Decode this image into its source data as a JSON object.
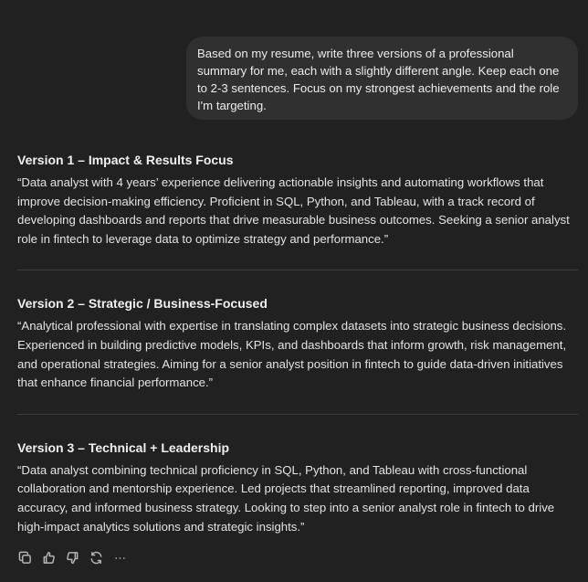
{
  "user_message": {
    "text": "Based on my resume, write three versions of a professional summary for me, each with a slightly different angle. Keep each one to 2-3 sentences. Focus on my strongest achievements and the role I'm targeting."
  },
  "assistant_response": {
    "versions": [
      {
        "title": "Version 1 – Impact & Results Focus",
        "body": "“Data analyst with 4 years’ experience delivering actionable insights and automating workflows that improve decision-making efficiency. Proficient in SQL, Python, and Tableau, with a track record of developing dashboards and reports that drive measurable business outcomes. Seeking a senior analyst role in fintech to leverage data to optimize strategy and performance.”"
      },
      {
        "title": "Version 2 – Strategic / Business-Focused",
        "body": "“Analytical professional with expertise in translating complex datasets into strategic business decisions. Experienced in building predictive models, KPIs, and dashboards that inform growth, risk management, and operational strategies. Aiming for a senior analyst position in fintech to guide data-driven initiatives that enhance financial performance.”"
      },
      {
        "title": "Version 3 – Technical + Leadership",
        "body": "“Data analyst combining technical proficiency in SQL, Python, and Tableau with cross-functional collaboration and mentorship experience. Led projects that streamlined reporting, improved data accuracy, and informed business strategy. Looking to step into a senior analyst role in fintech to drive high-impact analytics solutions and strategic insights.”"
      }
    ]
  },
  "action_bar": {
    "icons": [
      "copy-icon",
      "thumbs-up-icon",
      "thumbs-down-icon",
      "regenerate-icon",
      "more-icon"
    ]
  },
  "colors": {
    "background": "#212121",
    "user_bubble": "#303030",
    "text": "#ececec",
    "divider": "#3d3d3d",
    "icon": "#b4b4b4"
  }
}
